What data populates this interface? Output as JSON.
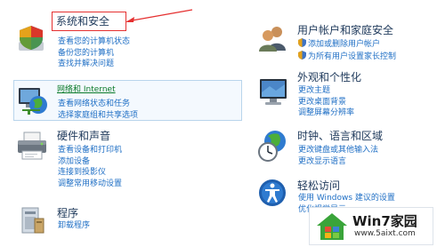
{
  "categories": {
    "system": {
      "title": "系统和安全",
      "links": [
        "查看您的计算机状态",
        "备份您的计算机",
        "查找并解决问题"
      ]
    },
    "network": {
      "title": "网络和 Internet",
      "links": [
        "查看网络状态和任务",
        "选择家庭组和共享选项"
      ]
    },
    "hardware": {
      "title": "硬件和声音",
      "links": [
        "查看设备和打印机",
        "添加设备",
        "连接到投影仪",
        "调整常用移动设置"
      ]
    },
    "programs": {
      "title": "程序",
      "links": [
        "卸载程序"
      ]
    },
    "users": {
      "title": "用户帐户和家庭安全",
      "links": [
        "添加或删除用户帐户",
        "为所有用户设置家长控制"
      ]
    },
    "appearance": {
      "title": "外观和个性化",
      "links": [
        "更改主题",
        "更改桌面背景",
        "调整屏幕分辨率"
      ]
    },
    "clock": {
      "title": "时钟、语言和区域",
      "links": [
        "更改键盘或其他输入法",
        "更改显示语言"
      ]
    },
    "ease": {
      "title": "轻松访问",
      "links": [
        "使用 Windows 建议的设置",
        "优化视觉显示"
      ]
    }
  },
  "watermark": {
    "name": "Win7家园",
    "url": "www.5aixt.com"
  },
  "colors": {
    "link": "#1f6fc5",
    "title": "#1e395b",
    "highlight": "#e53030"
  }
}
